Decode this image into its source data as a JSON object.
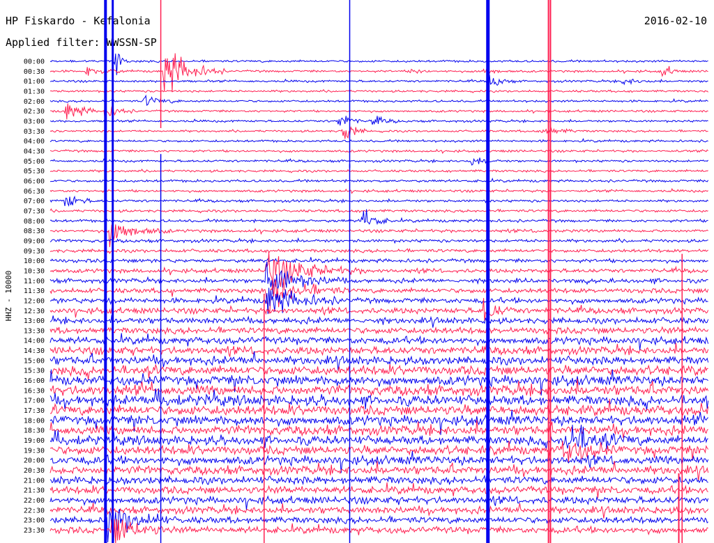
{
  "chart_data": {
    "type": "line",
    "title": "HP Fiskardo - Kefalonia",
    "date": "2016-02-10",
    "subtitle": "Applied filter: WWSSN-SP",
    "ylabel": "HHZ - 10000",
    "xlabel": "",
    "grid": false,
    "legend": "none",
    "colors": [
      "#0000ee",
      "#ff1e50"
    ],
    "row_times": [
      "00:00",
      "00:30",
      "01:00",
      "01:30",
      "02:00",
      "02:30",
      "03:00",
      "03:30",
      "04:00",
      "04:30",
      "05:00",
      "05:30",
      "06:00",
      "06:30",
      "07:00",
      "07:30",
      "08:00",
      "08:30",
      "09:00",
      "09:30",
      "10:00",
      "10:30",
      "11:00",
      "11:30",
      "12:00",
      "12:30",
      "13:00",
      "13:30",
      "14:00",
      "14:30",
      "15:00",
      "15:30",
      "16:00",
      "16:30",
      "17:00",
      "17:30",
      "18:00",
      "18:30",
      "19:00",
      "19:30",
      "20:00",
      "20:30",
      "21:00",
      "21:30",
      "22:00",
      "22:30",
      "23:00",
      "23:30"
    ],
    "noise_level": [
      0.1,
      0.1,
      0.1,
      0.1,
      0.1,
      0.1,
      0.1,
      0.1,
      0.11,
      0.11,
      0.12,
      0.12,
      0.13,
      0.13,
      0.14,
      0.15,
      0.16,
      0.18,
      0.2,
      0.22,
      0.25,
      0.28,
      0.32,
      0.36,
      0.4,
      0.44,
      0.48,
      0.52,
      0.58,
      0.62,
      0.7,
      0.78,
      0.82,
      0.85,
      0.85,
      0.85,
      0.8,
      0.78,
      0.75,
      0.74,
      0.72,
      0.7,
      0.65,
      0.6,
      0.58,
      0.56,
      0.54,
      0.52
    ],
    "events": [
      {
        "row": 0,
        "pos": 0.1,
        "amp": 3.0,
        "dur": 0.006
      },
      {
        "row": 1,
        "pos": 0.175,
        "amp": 4.0,
        "dur": 0.03
      },
      {
        "row": 1,
        "pos": 0.055,
        "amp": 0.8,
        "dur": 0.02
      },
      {
        "row": 1,
        "pos": 0.93,
        "amp": 1.2,
        "dur": 0.01
      },
      {
        "row": 1,
        "pos": 0.66,
        "amp": 0.6,
        "dur": 0.015
      },
      {
        "row": 1,
        "pos": 0.55,
        "amp": 0.6,
        "dur": 0.01
      },
      {
        "row": 2,
        "pos": 0.67,
        "amp": 1.2,
        "dur": 0.012
      },
      {
        "row": 2,
        "pos": 0.87,
        "amp": 0.5,
        "dur": 0.02
      },
      {
        "row": 4,
        "pos": 0.145,
        "amp": 0.9,
        "dur": 0.02
      },
      {
        "row": 5,
        "pos": 0.025,
        "amp": 1.6,
        "dur": 0.02
      },
      {
        "row": 5,
        "pos": 0.085,
        "amp": 1.4,
        "dur": 0.015
      },
      {
        "row": 6,
        "pos": 0.44,
        "amp": 1.5,
        "dur": 0.012
      },
      {
        "row": 6,
        "pos": 0.49,
        "amp": 0.8,
        "dur": 0.015
      },
      {
        "row": 7,
        "pos": 0.445,
        "amp": 2.5,
        "dur": 0.012
      },
      {
        "row": 7,
        "pos": 0.75,
        "amp": 0.8,
        "dur": 0.02
      },
      {
        "row": 10,
        "pos": 0.64,
        "amp": 0.8,
        "dur": 0.015
      },
      {
        "row": 14,
        "pos": 0.025,
        "amp": 1.3,
        "dur": 0.015
      },
      {
        "row": 16,
        "pos": 0.475,
        "amp": 2.0,
        "dur": 0.015
      },
      {
        "row": 17,
        "pos": 0.093,
        "amp": 2.2,
        "dur": 0.03
      },
      {
        "row": 21,
        "pos": 0.33,
        "amp": 3.0,
        "dur": 0.05
      },
      {
        "row": 22,
        "pos": 0.33,
        "amp": 3.0,
        "dur": 0.04
      },
      {
        "row": 23,
        "pos": 0.33,
        "amp": 3.0,
        "dur": 0.04
      },
      {
        "row": 24,
        "pos": 0.33,
        "amp": 2.5,
        "dur": 0.04
      },
      {
        "row": 25,
        "pos": 0.66,
        "amp": 2.0,
        "dur": 0.015
      },
      {
        "row": 38,
        "pos": 0.78,
        "amp": 2.5,
        "dur": 0.04
      },
      {
        "row": 39,
        "pos": 0.78,
        "amp": 1.8,
        "dur": 0.03
      },
      {
        "row": 46,
        "pos": 0.09,
        "amp": 3.0,
        "dur": 0.03
      },
      {
        "row": 47,
        "pos": 0.095,
        "amp": 2.5,
        "dur": 0.03
      }
    ],
    "spikes": [
      {
        "pos": 0.084,
        "rows": [
          0,
          47
        ],
        "color": "#0000ee",
        "width": 4
      },
      {
        "pos": 0.095,
        "rows": [
          0,
          47
        ],
        "color": "#0000ee",
        "width": 3
      },
      {
        "pos": 0.665,
        "rows": [
          0,
          47
        ],
        "color": "#0000ee",
        "width": 5
      },
      {
        "pos": 0.757,
        "rows": [
          0,
          47
        ],
        "color": "#ff1e50",
        "width": 2
      },
      {
        "pos": 0.76,
        "rows": [
          0,
          47
        ],
        "color": "#ff1e50",
        "width": 2
      },
      {
        "pos": 0.168,
        "rows": [
          10,
          47
        ],
        "color": "#0000ee",
        "width": 1.5
      },
      {
        "pos": 0.168,
        "rows": [
          0,
          6
        ],
        "color": "#ff1e50",
        "width": 1.5
      },
      {
        "pos": 0.455,
        "rows": [
          11,
          47
        ],
        "color": "#0000ee",
        "width": 1.5
      },
      {
        "pos": 0.325,
        "rows": [
          24,
          47
        ],
        "color": "#ff1e50",
        "width": 1.5
      },
      {
        "pos": 0.455,
        "rows": [
          0,
          10
        ],
        "color": "#0000ee",
        "width": 1.5
      },
      {
        "pos": 0.96,
        "rows": [
          20,
          47
        ],
        "color": "#ff1e50",
        "width": 1.5
      },
      {
        "pos": 0.955,
        "rows": [
          42,
          47
        ],
        "color": "#ff1e50",
        "width": 2
      }
    ]
  }
}
